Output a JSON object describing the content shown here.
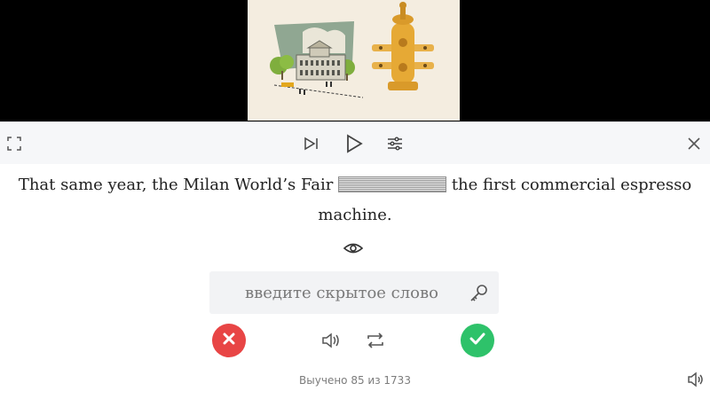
{
  "player": {
    "thumbnail_icon": "illustration-espresso-machine-and-building",
    "controls": {
      "fullscreen_icon": "fullscreen-icon",
      "next_icon": "skip-next-icon",
      "play_icon": "play-icon",
      "settings_icon": "settings-sliders-icon",
      "close_icon": "close-icon"
    }
  },
  "exercise": {
    "sentence_before": "That same year, the Milan World’s Fair ",
    "sentence_after": " the first commercial espresso machine.",
    "input_placeholder": "введите скрытое слово",
    "hint_icon": "key-icon",
    "reveal_icon": "eye-icon"
  },
  "actions": {
    "wrong_icon": "cross-icon",
    "correct_icon": "check-icon",
    "sound_icon": "speaker-icon",
    "repeat_icon": "repeat-icon"
  },
  "progress": {
    "text": "Выучено 85 из 1733",
    "learned": 85,
    "total": 1733
  },
  "colors": {
    "wrong": "#e84545",
    "correct": "#2ec26a",
    "controls_bg": "#f6f7f9"
  }
}
